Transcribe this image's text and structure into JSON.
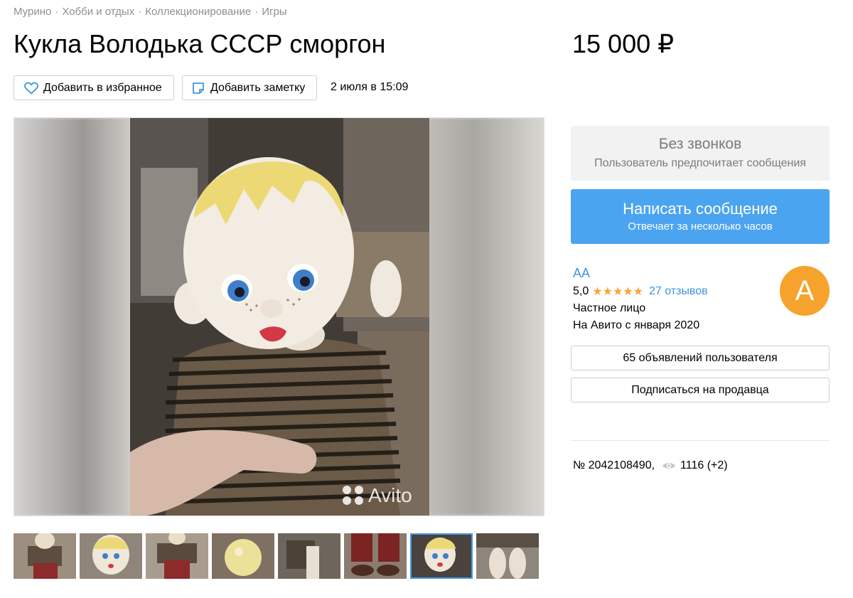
{
  "breadcrumb": [
    "Мурино",
    "Хобби и отдых",
    "Коллекционирование",
    "Игры"
  ],
  "listing": {
    "title": "Кукла Володька СССР сморгон",
    "price": "15 000 ₽",
    "date": "2 июля в 15:09",
    "number": "№ 2042108490,",
    "views": "1116 (+2)"
  },
  "actions": {
    "favorite_label": "Добавить в избранное",
    "note_label": "Добавить заметку"
  },
  "gallery": {
    "watermark": "Avito",
    "thumbnail_count": 8,
    "active_thumbnail": 7
  },
  "contact": {
    "no_calls_title": "Без звонков",
    "no_calls_subtitle": "Пользователь предпочитает сообщения",
    "message_title": "Написать сообщение",
    "message_subtitle": "Отвечает за несколько часов"
  },
  "seller": {
    "name": "АА",
    "rating": "5,0",
    "stars": 5,
    "reviews": "27 отзывов",
    "type": "Частное лицо",
    "since": "На Авито с января 2020",
    "avatar_letter": "А",
    "ads_button": "65 объявлений пользователя",
    "subscribe_button": "Подписаться на продавца"
  },
  "colors": {
    "accent_blue": "#4ba4f0",
    "link_blue": "#3e95de",
    "star": "#f8a532",
    "avatar": "#f6a32d"
  }
}
